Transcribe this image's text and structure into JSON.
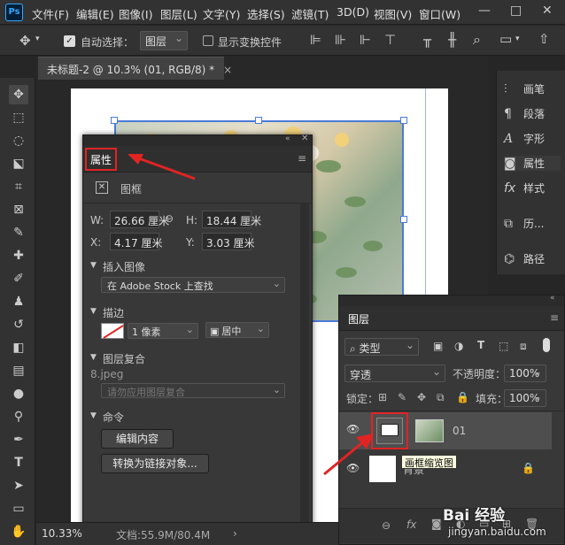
{
  "menubar": {
    "logo": "Ps",
    "items": [
      "文件(F)",
      "编辑(E)",
      "图像(I)",
      "图层(L)",
      "文字(Y)",
      "选择(S)",
      "滤镜(T)",
      "3D(D)",
      "视图(V)",
      "窗口(W)"
    ],
    "min": "—",
    "restore": "□",
    "close": "✕"
  },
  "options": {
    "auto_select_label": "自动选择：",
    "auto_select_value": "图层",
    "show_transform_label": "显示变换控件"
  },
  "tab": {
    "title": "未标题-2 @ 10.3% (01, RGB/8) *",
    "close": "×"
  },
  "status": {
    "zoom": "10.33%",
    "doc": "文档:55.9M/80.4M"
  },
  "properties": {
    "title": "属性",
    "frame_label": "图框",
    "w_label": "W:",
    "w_value": "26.66 厘米",
    "h_label": "H:",
    "h_value": "18.44 厘米",
    "x_label": "X:",
    "x_value": "4.17 厘米",
    "y_label": "Y:",
    "y_value": "3.03 厘米",
    "insert_image_label": "插入图像",
    "insert_image_value": "在 Adobe Stock 上查找",
    "stroke_label": "描边",
    "stroke_width": "1 像素",
    "stroke_align": "居中",
    "comp_label": "图层复合",
    "comp_file": "8.jpeg",
    "comp_value": "请勿应用图层复合",
    "commands_label": "命令",
    "edit_contents": "编辑内容",
    "convert_linked": "转换为链接对象..."
  },
  "right_panel": {
    "items": [
      "画笔",
      "段落",
      "字形",
      "属性",
      "样式",
      "历...",
      "路径"
    ]
  },
  "layers": {
    "title": "图层",
    "filter_type": "类型",
    "blend_mode": "穿透",
    "opacity_label": "不透明度：",
    "opacity_value": "100%",
    "lock_label": "锁定：",
    "fill_label": "填充：",
    "fill_value": "100%",
    "layer1_name": "01",
    "layer2_name": "背景",
    "tooltip": "画框缩览图"
  },
  "watermark": {
    "site": "jingyan.baidu.com",
    "brand": "Bai 经验"
  },
  "colors": {
    "accent": "#e02424",
    "selection": "#4a7bd8",
    "panel": "#383838"
  }
}
